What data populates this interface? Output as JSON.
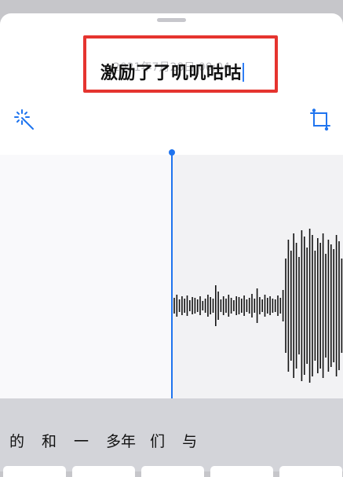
{
  "recording": {
    "title": "激励了了叽叽咕咕",
    "subtitle": "2021年7月28日 00:04"
  },
  "toolbar": {
    "enhance_icon": "magic-wand-icon",
    "crop_icon": "trim-crop-icon",
    "accent_color": "#1f74ef",
    "highlight_color": "#e5342f"
  },
  "keyboard": {
    "candidates": [
      "的",
      "和",
      "一",
      "多年",
      "们",
      "与"
    ]
  }
}
